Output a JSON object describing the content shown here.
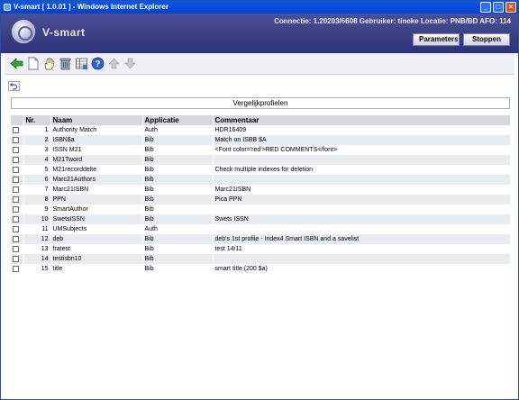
{
  "window": {
    "title": "V-smart [ 1.0.01 ] - Windows Internet Explorer"
  },
  "header": {
    "logo": "V-smart",
    "connection_info": "Connectie: 1.20203/6608   Gebruiker: tineke   Locatie: PNB/BD   AFO: 114",
    "buttons": {
      "parameters": "Parameters",
      "stoppen": "Stoppen"
    }
  },
  "toolbar": {
    "icons": [
      "back-arrow-icon",
      "new-document-icon",
      "hand-select-icon",
      "trash-icon",
      "grid-settings-icon",
      "help-icon",
      "arrow-up-icon",
      "arrow-down-icon"
    ]
  },
  "panel": {
    "title": "Vergelijkprofielen"
  },
  "table": {
    "headers": {
      "nr": "Nr.",
      "naam": "Naam",
      "applicatie": "Applicatie",
      "commentaar": "Commentaar"
    },
    "rows": [
      {
        "nr": "1",
        "naam": "Authority Match",
        "applicatie": "Auth",
        "commentaar": "HDR16409"
      },
      {
        "nr": "2",
        "naam": "ISBN$a",
        "applicatie": "Bib",
        "commentaar": "Match on ISBB $A"
      },
      {
        "nr": "3",
        "naam": "ISSN M21",
        "applicatie": "Bib",
        "commentaar": "<Font color='red'>RED COMMENTS</font>"
      },
      {
        "nr": "4",
        "naam": "M21Tword",
        "applicatie": "Bib",
        "commentaar": ""
      },
      {
        "nr": "5",
        "naam": "M21recorddelte",
        "applicatie": "Bib",
        "commentaar": "Check multiple indexes for deletion"
      },
      {
        "nr": "6",
        "naam": "Marc21Authors",
        "applicatie": "Bib",
        "commentaar": ""
      },
      {
        "nr": "7",
        "naam": "Marc21ISBN",
        "applicatie": "Bib",
        "commentaar": "Marc21ISBN"
      },
      {
        "nr": "8",
        "naam": "PPN",
        "applicatie": "Bib",
        "commentaar": "Pica PPN"
      },
      {
        "nr": "9",
        "naam": "SmartAuthor",
        "applicatie": "Bib",
        "commentaar": ""
      },
      {
        "nr": "10",
        "naam": "SwetsISSN",
        "applicatie": "Bib",
        "commentaar": "Swets ISSN"
      },
      {
        "nr": "11",
        "naam": "UMSubjects",
        "applicatie": "Auth",
        "commentaar": ""
      },
      {
        "nr": "12",
        "naam": "deb",
        "applicatie": "Bib",
        "commentaar": "deb's 1st profile - Index4 Smart ISBN and a savelist"
      },
      {
        "nr": "13",
        "naam": "fratest",
        "applicatie": "Bib",
        "commentaar": "test 14/11"
      },
      {
        "nr": "14",
        "naam": "testisbn10",
        "applicatie": "Bib",
        "commentaar": ""
      },
      {
        "nr": "15",
        "naam": "title",
        "applicatie": "Bib",
        "commentaar": "smart title (200 $a)"
      }
    ]
  }
}
